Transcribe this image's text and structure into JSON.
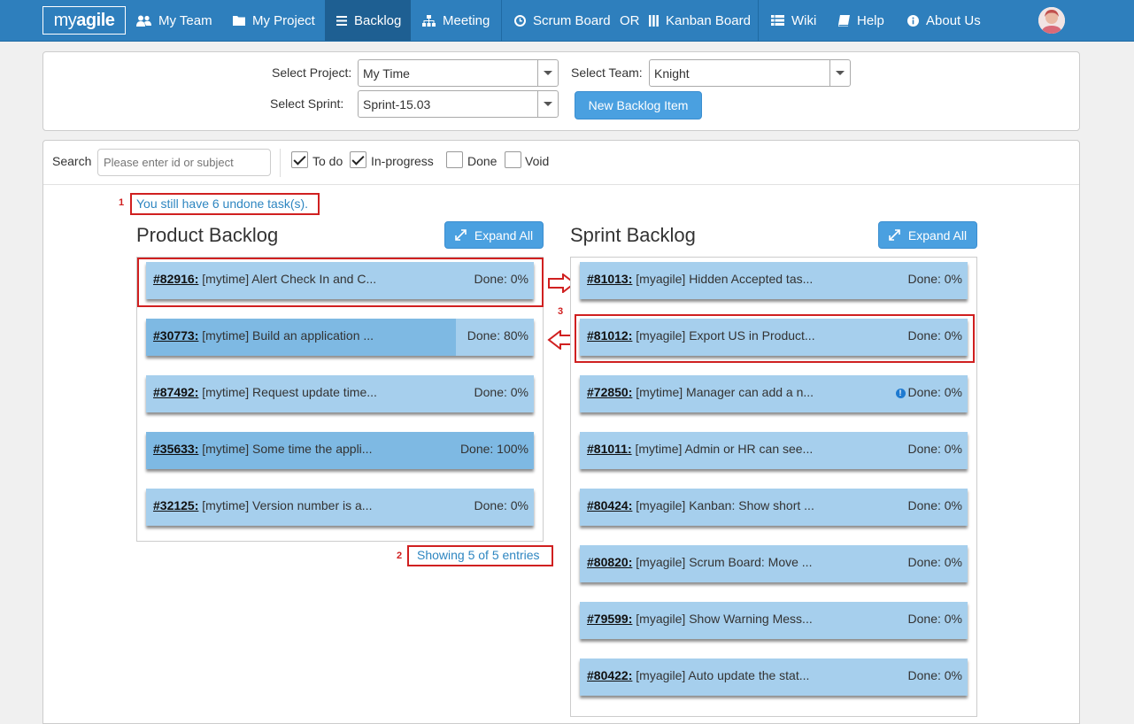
{
  "nav": {
    "brand_left": "my ",
    "brand_right": "agile",
    "my_team": "My Team",
    "my_project": "My Project",
    "backlog": "Backlog",
    "meeting": "Meeting",
    "scrum_board": "Scrum Board",
    "or": "OR",
    "kanban_board": "Kanban Board",
    "wiki": "Wiki",
    "help": "Help",
    "about_us": "About Us"
  },
  "filters": {
    "project_label": "Select Project:",
    "project_value": "My Time",
    "team_label": "Select Team:",
    "team_value": "Knight",
    "sprint_label": "Select Sprint:",
    "sprint_value": "Sprint-15.03",
    "new_item_button": "New Backlog Item"
  },
  "search": {
    "label": "Search",
    "placeholder": "Please enter id or subject",
    "statuses": [
      {
        "label": "To do",
        "checked": true
      },
      {
        "label": "In-progress",
        "checked": true
      },
      {
        "label": "Done",
        "checked": false
      },
      {
        "label": "Void",
        "checked": false
      }
    ]
  },
  "annotations": {
    "n1": "1",
    "n2": "2",
    "n3": "3"
  },
  "undone_message": "You still have 6 undone task(s).",
  "product_backlog": {
    "title": "Product Backlog",
    "expand_all": "Expand All",
    "showing": "Showing 5 of 5 entries",
    "items": [
      {
        "id": "#82916:",
        "subject": "[mytime] Alert Check In and C...",
        "done": "Done: 0%",
        "progress": 0
      },
      {
        "id": "#30773:",
        "subject": "[mytime] Build an application ...",
        "done": "Done: 80%",
        "progress": 80
      },
      {
        "id": "#87492:",
        "subject": "[mytime] Request update time...",
        "done": "Done: 0%",
        "progress": 0
      },
      {
        "id": "#35633:",
        "subject": "[mytime] Some time the appli...",
        "done": "Done: 100%",
        "progress": 100
      },
      {
        "id": "#32125:",
        "subject": "[mytime] Version number is a...",
        "done": "Done: 0%",
        "progress": 0
      }
    ]
  },
  "sprint_backlog": {
    "title": "Sprint Backlog",
    "expand_all": "Expand All",
    "items": [
      {
        "id": "#81013:",
        "subject": "[myagile] Hidden Accepted tas...",
        "done": "Done: 0%",
        "progress": 0
      },
      {
        "id": "#81012:",
        "subject": "[myagile] Export US in Product...",
        "done": "Done: 0%",
        "progress": 0
      },
      {
        "id": "#72850:",
        "subject": "[mytime] Manager can add a n...",
        "done": "Done: 0%",
        "progress": 0,
        "info": "!"
      },
      {
        "id": "#81011:",
        "subject": "[mytime] Admin or HR can see...",
        "done": "Done: 0%",
        "progress": 0
      },
      {
        "id": "#80424:",
        "subject": "[myagile] Kanban: Show short ...",
        "done": "Done: 0%",
        "progress": 0
      },
      {
        "id": "#80820:",
        "subject": "[myagile] Scrum Board: Move ...",
        "done": "Done: 0%",
        "progress": 0
      },
      {
        "id": "#79599:",
        "subject": "[myagile] Show Warning Mess...",
        "done": "Done: 0%",
        "progress": 0
      },
      {
        "id": "#80422:",
        "subject": "[myagile] Auto update the stat...",
        "done": "Done: 0%",
        "progress": 0
      }
    ]
  }
}
